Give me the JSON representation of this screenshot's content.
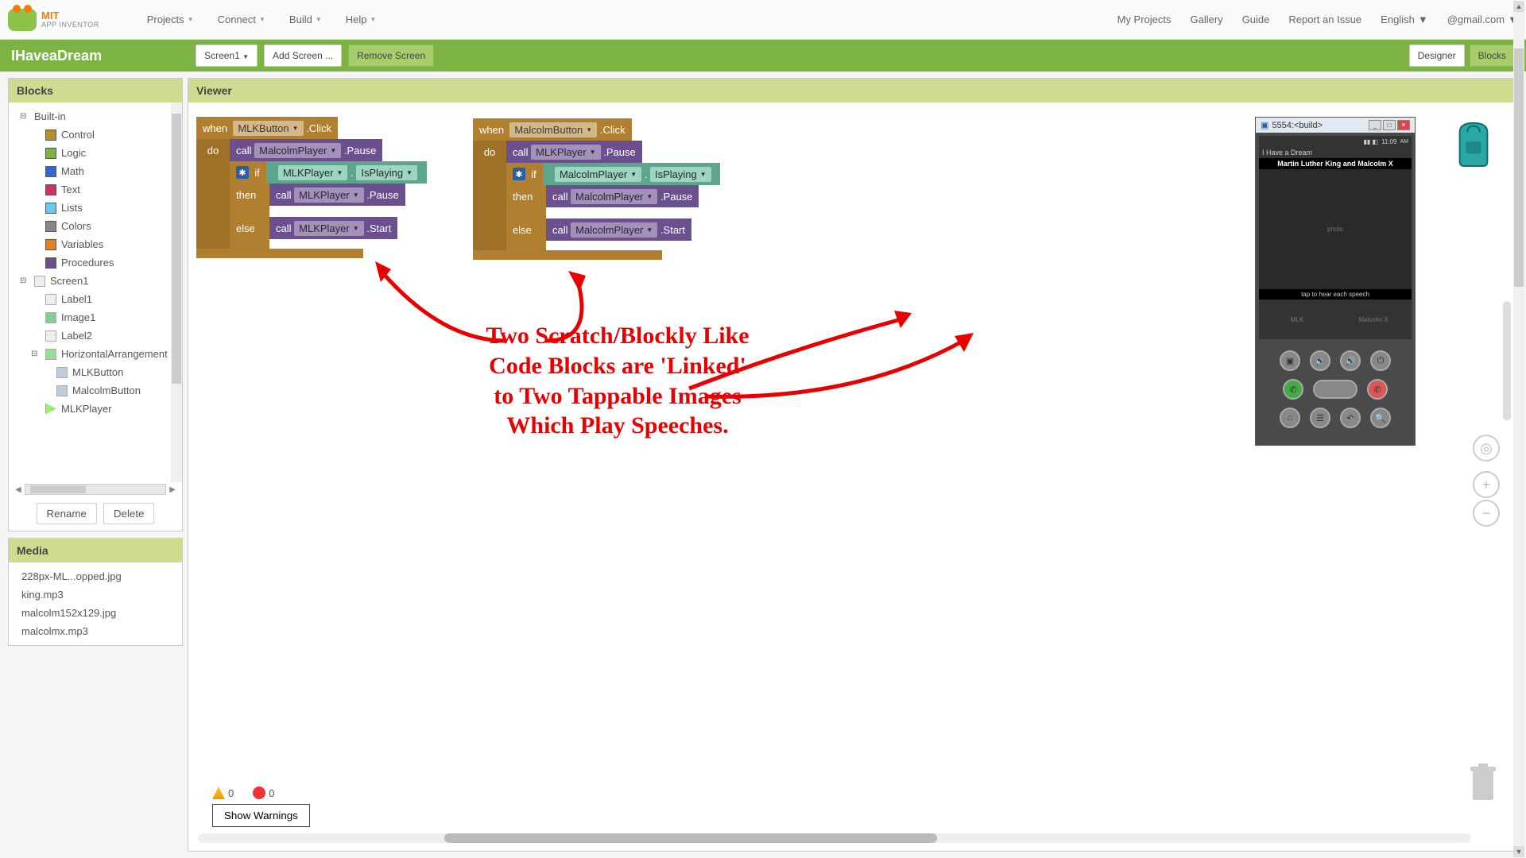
{
  "brand": {
    "top": "MIT",
    "bottom": "APP INVENTOR"
  },
  "topnav": {
    "projects": "Projects",
    "connect": "Connect",
    "build": "Build",
    "help": "Help"
  },
  "toplinks": {
    "myprojects": "My Projects",
    "gallery": "Gallery",
    "guide": "Guide",
    "report": "Report an Issue",
    "english": "English",
    "user": "@gmail.com"
  },
  "titlebar": {
    "project": "IHaveaDream",
    "screen": "Screen1",
    "addscreen": "Add Screen ...",
    "removescreen": "Remove Screen",
    "designer": "Designer",
    "blocks": "Blocks"
  },
  "panels": {
    "blocks": "Blocks",
    "viewer": "Viewer",
    "media": "Media"
  },
  "tree": {
    "builtin": "Built-in",
    "control": "Control",
    "logic": "Logic",
    "math": "Math",
    "text": "Text",
    "lists": "Lists",
    "colors": "Colors",
    "variables": "Variables",
    "procedures": "Procedures",
    "screen1": "Screen1",
    "label1": "Label1",
    "image1": "Image1",
    "label2": "Label2",
    "harr": "HorizontalArrangement",
    "mlkbutton": "MLKButton",
    "malcolmbutton": "MalcolmButton",
    "mlkplayer": "MLKPlayer"
  },
  "sidebtns": {
    "rename": "Rename",
    "delete": "Delete"
  },
  "media": {
    "f1": "228px-ML...opped.jpg",
    "f2": "king.mp3",
    "f3": "malcolm152x129.jpg",
    "f4": "malcolmx.mp3"
  },
  "blocksCode": {
    "g1": {
      "event_when": "when",
      "event_target": "MLKButton",
      "event_evt": ".Click",
      "do": "do",
      "call": "call",
      "malcolm": "MalcolmPlayer",
      "pause": ".Pause",
      "if": "if",
      "mlk": "MLKPlayer",
      "dot": ".",
      "isplaying": "IsPlaying",
      "then": "then",
      "else": "else",
      "start": ".Start"
    },
    "g2": {
      "event_when": "when",
      "event_target": "MalcolmButton",
      "event_evt": ".Click",
      "do": "do",
      "call": "call",
      "mlk": "MLKPlayer",
      "pause": ".Pause",
      "if": "if",
      "malcolm": "MalcolmPlayer",
      "dot": ".",
      "isplaying": "IsPlaying",
      "then": "then",
      "else": "else",
      "start": ".Start"
    }
  },
  "annotation": {
    "l1": "Two Scratch/Blockly Like",
    "l2": "Code Blocks are 'Linked'",
    "l3": "to Two Tappable Images",
    "l4": "Which Play Speeches."
  },
  "phone": {
    "wintitle": "5554:<build>",
    "time": "11:09",
    "am": "AM",
    "appbar": "I Have a Dream",
    "title": "Martin Luther King and Malcolm X",
    "caption": "tap to hear each speech"
  },
  "warnings": {
    "warn": "0",
    "err": "0",
    "btn": "Show Warnings"
  }
}
